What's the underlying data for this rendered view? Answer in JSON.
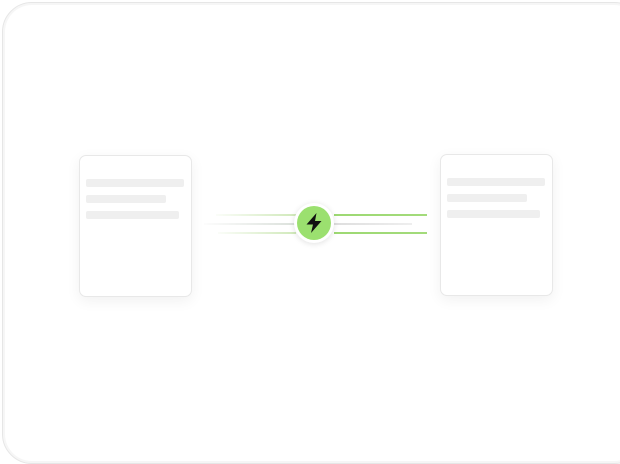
{
  "canvas": {
    "background": "#ffffff",
    "border_color": "#e6e6e6"
  },
  "left_card": {
    "kind": "document-placeholder",
    "skeleton_lines": 3
  },
  "right_card": {
    "kind": "document-placeholder",
    "skeleton_lines": 3
  },
  "hub": {
    "icon": "lightning-bolt-icon",
    "fill_color": "#9be06f",
    "icon_color": "#111111"
  },
  "connector": {
    "accent_color": "#8cd25a",
    "neutral_color": "#c8c8c8"
  }
}
